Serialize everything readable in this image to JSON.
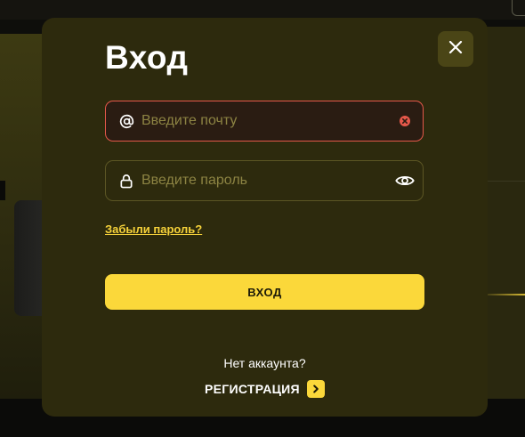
{
  "modal": {
    "title": "Вход",
    "close_icon": "close-icon"
  },
  "email": {
    "placeholder": "Введите почту",
    "value": "",
    "lead_icon": "at-icon",
    "trail_icon": "clear-icon",
    "state": "error"
  },
  "password": {
    "placeholder": "Введите пароль",
    "value": "",
    "lead_icon": "lock-icon",
    "trail_icon": "eye-icon"
  },
  "forgot_password_label": "Забыли пароль?",
  "login_button_label": "ВХОД",
  "no_account_text": "Нет аккаунта?",
  "register_label": "РЕГИСТРАЦИЯ",
  "register_icon": "chevron-right-icon",
  "colors": {
    "modal_bg": "#2d2a0d",
    "accent": "#fbd83a",
    "error": "#e4584a",
    "placeholder": "#8d8443"
  }
}
